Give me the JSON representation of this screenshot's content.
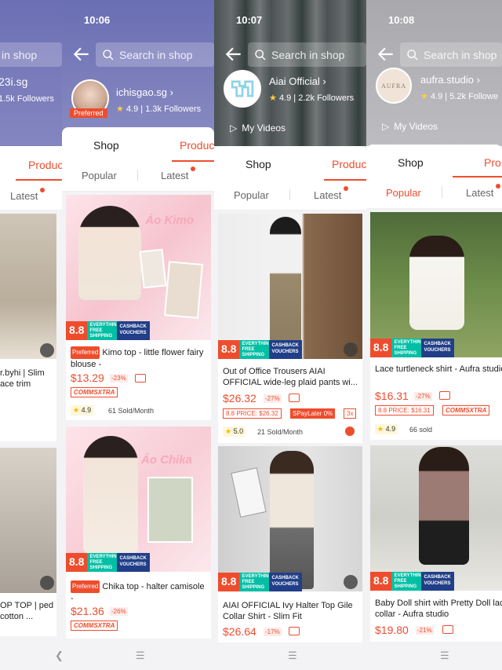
{
  "panels": [
    {
      "id": "p1",
      "search_placeholder": "in shop",
      "shop_name": "23i.sg",
      "followers": "1.5k Followers",
      "tab_product": "Produc",
      "subtab_latest": "Latest",
      "products": [
        {
          "title": "r.byhi | Slim ace trim"
        },
        {
          "title": "OP TOP | ped cotton ..."
        }
      ]
    },
    {
      "id": "p2",
      "time": "10:06",
      "search_placeholder": "Search in shop",
      "shop_name": "ichisgao.sg",
      "rating": "4.9",
      "followers": "1.3k Followers",
      "preferred": "Preferred",
      "tab_shop": "Shop",
      "tab_product": "Produc",
      "subtab_popular": "Popular",
      "subtab_latest": "Latest",
      "products": [
        {
          "img_text": "Áo Kimo",
          "preferred": "Preferred",
          "title": "Kimo top - little flower fairy blouse -",
          "price": "$13.29",
          "discount": "-23%",
          "tag": "COMMSXTRA",
          "rating": "4.9",
          "sold": "61 Sold/Month"
        },
        {
          "img_text": "Áo Chika",
          "preferred": "Preferred",
          "title": "Chika top - halter camisole -",
          "price": "$21.36",
          "discount": "-26%",
          "tag": "COMMSXTRA"
        }
      ]
    },
    {
      "id": "p3",
      "time": "10:07",
      "search_placeholder": "Search in shop",
      "shop_name": "Aiai Official",
      "rating": "4.9",
      "followers": "2.2k Followers",
      "my_videos": "My Videos",
      "tab_shop": "Shop",
      "tab_product": "Produc",
      "subtab_popular": "Popular",
      "subtab_latest": "Latest",
      "products": [
        {
          "title": "Out of Office Trousers AIAI OFFICIAL wide-leg plaid pants wi...",
          "price": "$26.32",
          "discount": "-27%",
          "price_tag": "8.8 PRICE: $26.32",
          "spay": "SPayLater 0%",
          "installments": "3x",
          "rating": "5.0",
          "sold": "21 Sold/Month"
        },
        {
          "title": "AIAI OFFICIAL Ivy Halter Top Gile Collar Shirt - Slim Fit",
          "price": "$26.64",
          "discount": "-17%"
        }
      ]
    },
    {
      "id": "p4",
      "time": "10:08",
      "search_placeholder": "Search in shop",
      "shop_name": "aufra.studio",
      "rating": "4.9",
      "followers": "5.2k Followe",
      "avatar_text": "AUFRA",
      "my_videos": "My Videos",
      "tab_shop": "Shop",
      "tab_product": "Pro",
      "subtab_popular": "Popular",
      "subtab_latest": "Latest",
      "products": [
        {
          "title": "Lace turtleneck shirt - Aufra studio",
          "price": "$16.31",
          "discount": "-27%",
          "price_tag": "8.8 PRICE: $16.31",
          "tag": "COMMSXTRA",
          "rating": "4.9",
          "sold": "66 sold"
        },
        {
          "title": "Baby Doll shirt with Pretty Doll lace collar - Aufra studio",
          "price": "$19.80",
          "discount": "-21%"
        }
      ]
    }
  ],
  "badge": {
    "number": "8.8",
    "free_shipping": "EVERYTHING FREE SHIPPING",
    "cashback": "CASHBACK VOUCHERS"
  },
  "colors": {
    "accent": "#ee4d2d",
    "badge_green": "#00bfa5",
    "badge_navy": "#213f88"
  }
}
